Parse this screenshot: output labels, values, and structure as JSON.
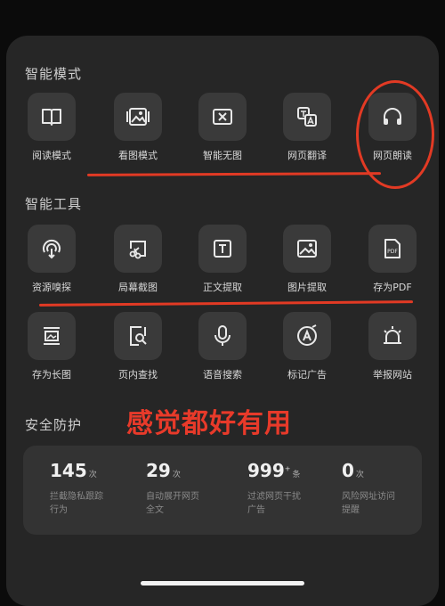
{
  "sections": {
    "smart_mode": "智能模式",
    "smart_tools": "智能工具",
    "security": "安全防护"
  },
  "smart_mode_items": [
    {
      "label": "阅读模式",
      "icon": "book-icon"
    },
    {
      "label": "看图模式",
      "icon": "gallery-icon"
    },
    {
      "label": "智能无图",
      "icon": "no-image-icon"
    },
    {
      "label": "网页翻译",
      "icon": "translate-icon"
    },
    {
      "label": "网页朗读",
      "icon": "headphones-icon"
    }
  ],
  "smart_tools_items": [
    {
      "label": "资源嗅探",
      "icon": "sniff-icon"
    },
    {
      "label": "局幕截图",
      "icon": "screenshot-icon"
    },
    {
      "label": "正文提取",
      "icon": "text-extract-icon"
    },
    {
      "label": "图片提取",
      "icon": "image-extract-icon"
    },
    {
      "label": "存为PDF",
      "icon": "pdf-icon"
    },
    {
      "label": "存为长图",
      "icon": "long-image-icon"
    },
    {
      "label": "页内查找",
      "icon": "find-in-page-icon"
    },
    {
      "label": "语音搜索",
      "icon": "microphone-icon"
    },
    {
      "label": "标记广告",
      "icon": "mark-ad-icon"
    },
    {
      "label": "举报网站",
      "icon": "alarm-icon"
    }
  ],
  "overlay_text": "感觉都好有用",
  "stats": [
    {
      "value": "145",
      "unit": "次",
      "sup": "",
      "desc": "拦截隐私跟踪行为"
    },
    {
      "value": "29",
      "unit": "次",
      "sup": "",
      "desc": "自动展开网页全文"
    },
    {
      "value": "999",
      "unit": "条",
      "sup": "+",
      "desc": "过滤网页干扰广告"
    },
    {
      "value": "0",
      "unit": "次",
      "sup": "",
      "desc": "风险网址访问提醒"
    }
  ],
  "colors": {
    "background": "#0b0b0b",
    "panel": "#262626",
    "tile": "#3a3a3a",
    "annotation": "#e23a24"
  }
}
